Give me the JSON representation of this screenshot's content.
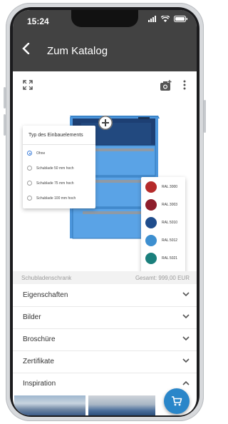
{
  "status_bar": {
    "time": "15:24"
  },
  "app_bar": {
    "back_icon": "arrow-back-icon",
    "title": "Zum Katalog"
  },
  "toolbar": {
    "expand_icon": "fullscreen-icon",
    "camera_icon": "add-camera-icon",
    "more_icon": "more-vert-icon"
  },
  "insert_popup": {
    "title": "Typ des Einbauelements",
    "options": [
      {
        "label": "Ohne",
        "selected": true
      },
      {
        "label": "Schublade 50 mm hoch",
        "selected": false
      },
      {
        "label": "Schublade 75 mm hoch",
        "selected": false
      },
      {
        "label": "Schublade 100 mm hoch",
        "selected": false
      }
    ]
  },
  "color_panel": {
    "swatches": [
      {
        "label": "RAL 3000",
        "color": "#b52a2a"
      },
      {
        "label": "RAL 3003",
        "color": "#8e1e2b"
      },
      {
        "label": "RAL 5010",
        "color": "#1f4d8c"
      },
      {
        "label": "RAL 5012",
        "color": "#3d8fd0"
      },
      {
        "label": "RAL 5021",
        "color": "#1a7f7c"
      }
    ]
  },
  "product_info": {
    "name": "Schubladenschrank",
    "total": "Gesamt: 999,00 EUR"
  },
  "accordion": [
    {
      "label": "Eigenschaften",
      "expanded": false
    },
    {
      "label": "Bilder",
      "expanded": false
    },
    {
      "label": "Broschüre",
      "expanded": false
    },
    {
      "label": "Zertifikate",
      "expanded": false
    },
    {
      "label": "Inspiration",
      "expanded": true
    }
  ],
  "fab": {
    "icon": "shopping-cart-icon"
  },
  "colors": {
    "app_bar": "#424242",
    "cabinet": "#4d97dd",
    "accent": "#2a86c9"
  }
}
